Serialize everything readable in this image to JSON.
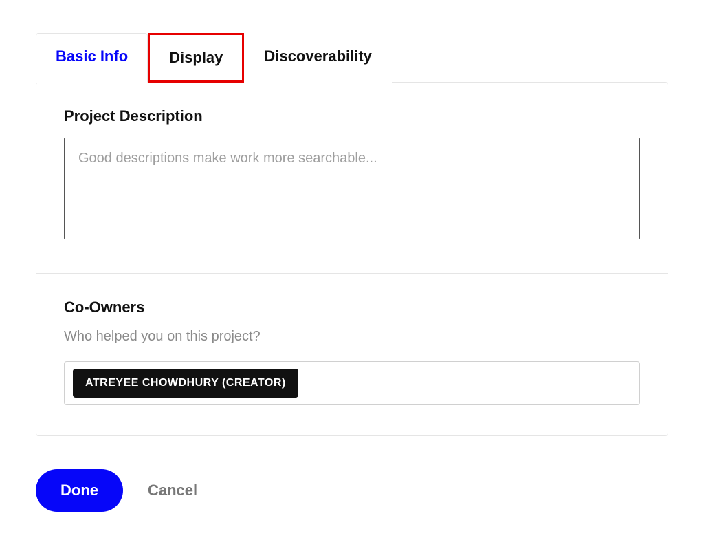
{
  "tabs": {
    "basic_info": "Basic Info",
    "display": "Display",
    "discoverability": "Discoverability"
  },
  "sections": {
    "description": {
      "title": "Project Description",
      "placeholder": "Good descriptions make work more searchable...",
      "value": ""
    },
    "coowners": {
      "title": "Co-Owners",
      "subtitle": "Who helped you on this project?",
      "chips": [
        "ATREYEE CHOWDHURY (CREATOR)"
      ]
    }
  },
  "buttons": {
    "done": "Done",
    "cancel": "Cancel"
  }
}
